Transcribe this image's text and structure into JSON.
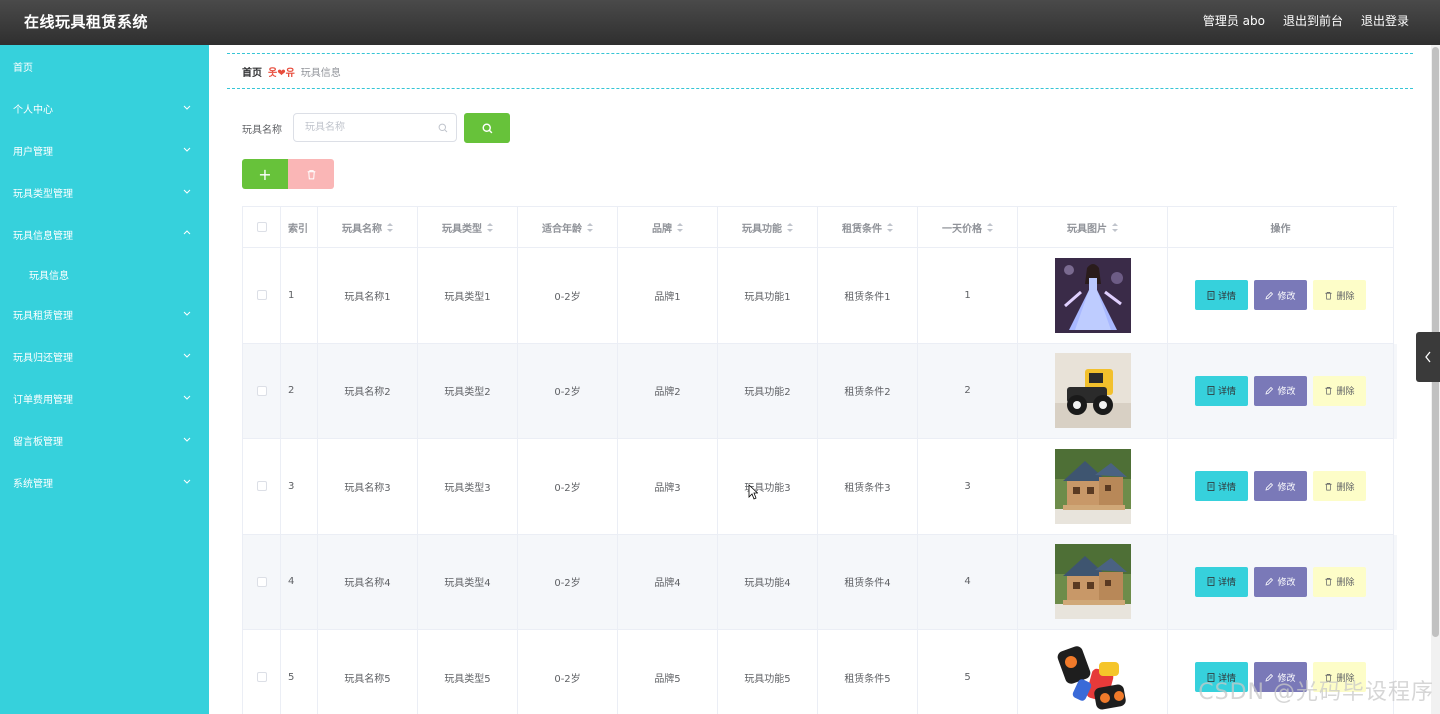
{
  "app": {
    "title": "在线玩具租赁系统"
  },
  "header": {
    "admin": "管理员 abo",
    "to_front": "退出到前台",
    "logout": "退出登录"
  },
  "sidebar": {
    "items": [
      {
        "label": "首页"
      },
      {
        "label": "个人中心"
      },
      {
        "label": "用户管理"
      },
      {
        "label": "玩具类型管理"
      },
      {
        "label": "玩具信息管理"
      },
      {
        "label": "玩具信息"
      },
      {
        "label": "玩具租赁管理"
      },
      {
        "label": "玩具归还管理"
      },
      {
        "label": "订单费用管理"
      },
      {
        "label": "留言板管理"
      },
      {
        "label": "系统管理"
      }
    ]
  },
  "breadcrumb": {
    "home": "首页",
    "sep": "옷❤유",
    "current": "玩具信息"
  },
  "search": {
    "label": "玩具名称",
    "placeholder": "玩具名称"
  },
  "table": {
    "headers": [
      "索引",
      "玩具名称",
      "玩具类型",
      "适合年龄",
      "品牌",
      "玩具功能",
      "租赁条件",
      "一天价格",
      "玩具图片",
      "操作"
    ],
    "rows": [
      {
        "idx": "1",
        "name": "玩具名称1",
        "type": "玩具类型1",
        "age": "0-2岁",
        "brand": "品牌1",
        "func": "玩具功能1",
        "cond": "租赁条件1",
        "price": "1",
        "img": "doll"
      },
      {
        "idx": "2",
        "name": "玩具名称2",
        "type": "玩具类型2",
        "age": "0-2岁",
        "brand": "品牌2",
        "func": "玩具功能2",
        "cond": "租赁条件2",
        "price": "2",
        "img": "truck"
      },
      {
        "idx": "3",
        "name": "玩具名称3",
        "type": "玩具类型3",
        "age": "0-2岁",
        "brand": "品牌3",
        "func": "玩具功能3",
        "cond": "租赁条件3",
        "price": "3",
        "img": "house"
      },
      {
        "idx": "4",
        "name": "玩具名称4",
        "type": "玩具类型4",
        "age": "0-2岁",
        "brand": "品牌4",
        "func": "玩具功能4",
        "cond": "租赁条件4",
        "price": "4",
        "img": "house"
      },
      {
        "idx": "5",
        "name": "玩具名称5",
        "type": "玩具类型5",
        "age": "0-2岁",
        "brand": "品牌5",
        "func": "玩具功能5",
        "cond": "租赁条件5",
        "price": "5",
        "img": "blocks"
      }
    ],
    "actions": {
      "detail": "详情",
      "edit": "修改",
      "delete": "删除"
    }
  },
  "watermark": "CSDN @光码毕设程序",
  "colors": {
    "sidebar": "#36d1dc",
    "header": "#3a3a3a",
    "success": "#67c23a",
    "danger_light": "#fab6b6",
    "edit": "#7a79b8",
    "delete": "#fdfdc8"
  }
}
